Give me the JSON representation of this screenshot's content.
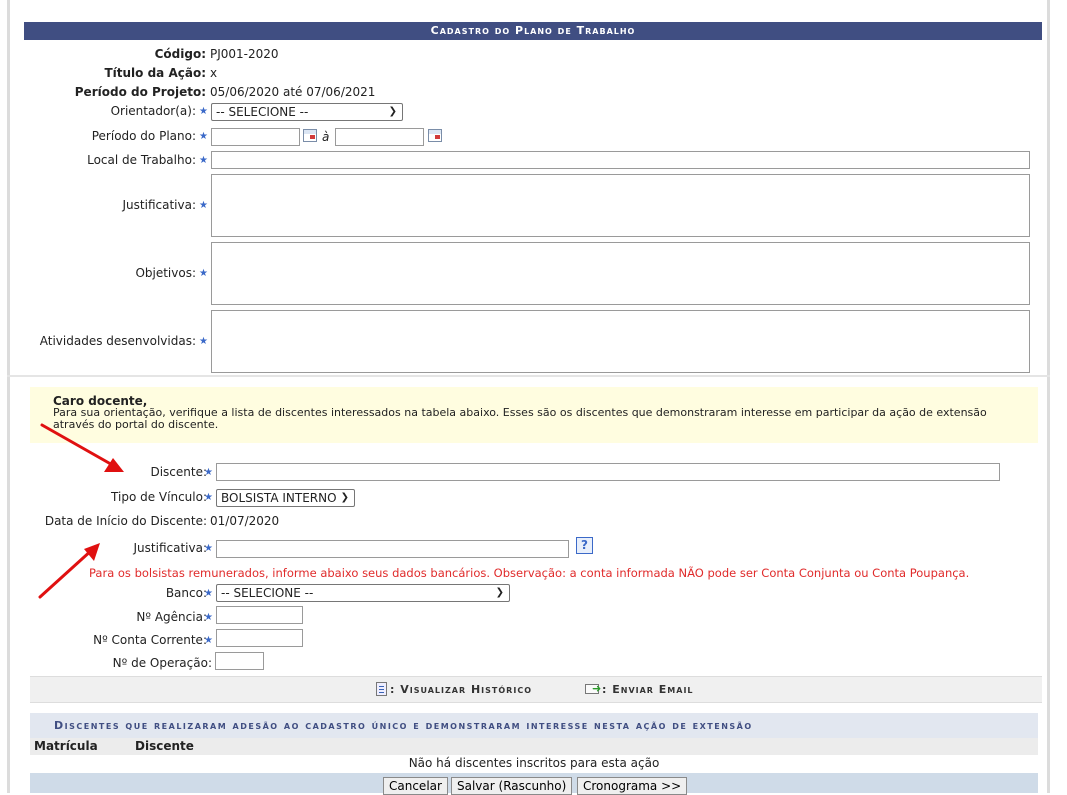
{
  "form_top": {
    "caption": "Cadastro do Plano de Trabalho",
    "codigo": {
      "label": "Código:",
      "value": "PJ001-2020"
    },
    "titulo": {
      "label": "Título da Ação:",
      "value": "x"
    },
    "periodo_projeto": {
      "label": "Período do Projeto:",
      "value": "05/06/2020 até 07/06/2021"
    },
    "orientador": {
      "label": "Orientador(a):",
      "selected": "-- SELECIONE --"
    },
    "periodo_plano": {
      "label": "Período do Plano:",
      "separator": "à",
      "start": "",
      "end": ""
    },
    "local_trabalho": {
      "label": "Local de Trabalho:",
      "value": ""
    },
    "justificativa": {
      "label": "Justificativa:",
      "value": ""
    },
    "objetivos": {
      "label": "Objetivos:",
      "value": ""
    },
    "atividades": {
      "label": "Atividades desenvolvidas:",
      "value": ""
    }
  },
  "notice": {
    "title": "Caro docente,",
    "text": "Para sua orientação, verifique a lista de discentes interessados na tabela abaixo. Esses são os discentes que demonstraram interesse em participar da ação de extensão através do portal do discente."
  },
  "form_bottom": {
    "discente": {
      "label": "Discente:",
      "value": ""
    },
    "tipo_vinculo": {
      "label": "Tipo de Vínculo:",
      "selected": "BOLSISTA INTERNO"
    },
    "data_inicio": {
      "label": "Data de Início do Discente:",
      "value": "01/07/2020"
    },
    "justificativa": {
      "label": "Justificativa:",
      "value": "",
      "help": "?"
    },
    "warning": "Para os bolsistas remunerados, informe abaixo seus dados bancários. Observação: a conta informada NÃO pode ser Conta Conjunta ou Conta Poupança.",
    "banco": {
      "label": "Banco:",
      "selected": "-- SELECIONE --"
    },
    "agencia": {
      "label": "Nº Agência:",
      "value": ""
    },
    "conta": {
      "label": "Nº Conta Corrente:",
      "value": ""
    },
    "operacao": {
      "label": "Nº de Operação:",
      "value": ""
    }
  },
  "actions": {
    "historico": ": Visualizar Histórico",
    "email": ": Enviar Email"
  },
  "discentes_list": {
    "caption": "Discentes que realizaram adesão ao cadastro único e demonstraram interesse nesta ação de extensão",
    "columns": [
      "Matrícula",
      "Discente"
    ],
    "empty_message": "Não há discentes inscritos para esta ação"
  },
  "buttons": {
    "cancelar": "Cancelar",
    "salvar": "Salvar (Rascunho)",
    "cronograma": "Cronograma >>"
  },
  "icons": {
    "required": "star-icon",
    "calendar": "calendar-icon",
    "help": "help-icon",
    "history": "document-icon",
    "email": "email-send-icon"
  },
  "colors": {
    "caption_bg": "#404e82",
    "required_star": "#3b69c8",
    "warning_text": "#e02b2b",
    "notice_bg": "#fffde0",
    "annotation_arrow": "#e01010"
  }
}
